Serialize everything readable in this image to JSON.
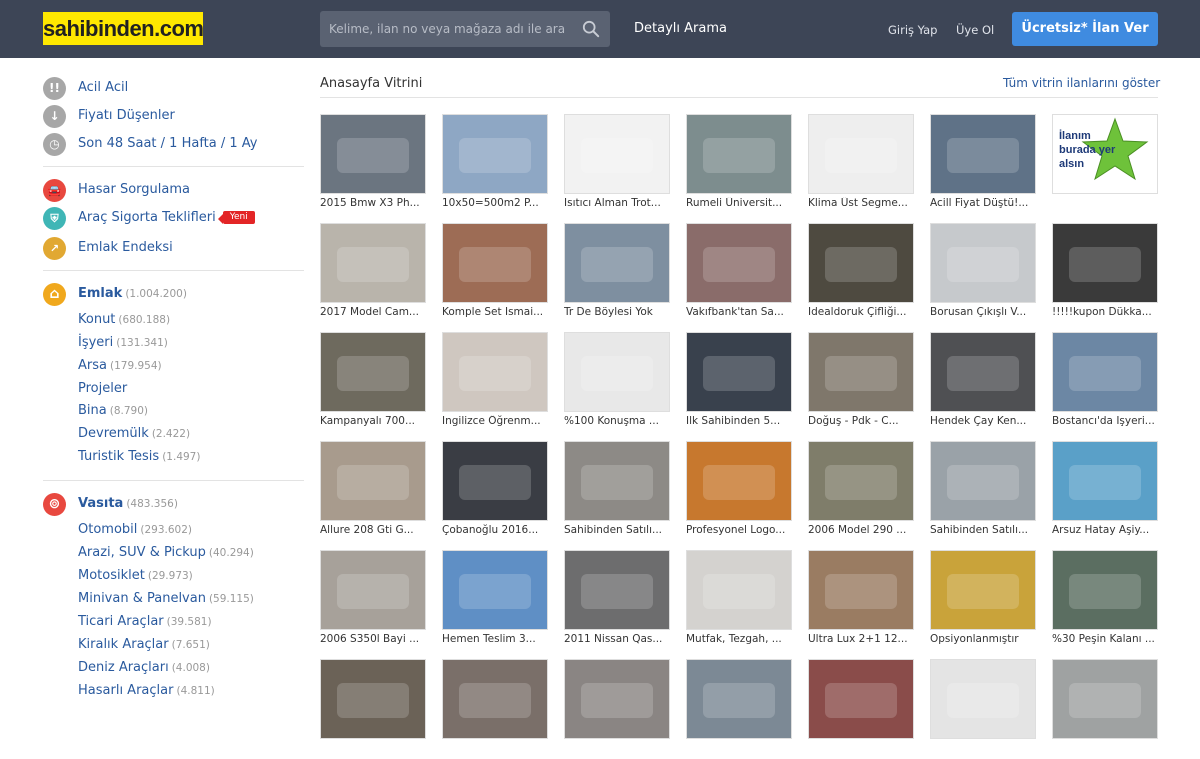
{
  "header": {
    "logo": "sahibinden.com",
    "search_placeholder": "Kelime, ilan no veya mağaza adı ile ara",
    "detailed_search": "Detaylı Arama",
    "login": "Giriş Yap",
    "register": "Üye Ol",
    "post_ad": "Ücretsiz* İlan Ver"
  },
  "sidebar": {
    "quick": [
      {
        "label": "Acil Acil",
        "icon": "exclamation-icon",
        "color": "#a7a7a7",
        "glyph": "!!"
      },
      {
        "label": "Fiyatı Düşenler",
        "icon": "arrow-down-icon",
        "color": "#a7a7a7",
        "glyph": "↓"
      },
      {
        "label": "Son 48 Saat / 1 Hafta / 1 Ay",
        "icon": "clock-icon",
        "color": "#a7a7a7",
        "glyph": "◷"
      }
    ],
    "tools": [
      {
        "label": "Hasar Sorgulama",
        "icon": "car-damage-icon",
        "color": "#e8483f",
        "glyph": "🚘"
      },
      {
        "label": "Araç Sigorta Teklifleri",
        "icon": "car-insurance-icon",
        "color": "#3fb6b6",
        "glyph": "⛨",
        "badge": "Yeni"
      },
      {
        "label": "Emlak Endeksi",
        "icon": "chart-icon",
        "color": "#e1a832",
        "glyph": "↗"
      }
    ],
    "emlak": {
      "title": "Emlak",
      "count": "(1.004.200)",
      "icon": "home-icon",
      "color": "#f0a81d",
      "items": [
        {
          "label": "Konut",
          "count": "(680.188)"
        },
        {
          "label": "İşyeri",
          "count": "(131.341)"
        },
        {
          "label": "Arsa",
          "count": "(179.954)"
        },
        {
          "label": "Projeler",
          "count": ""
        },
        {
          "label": "Bina",
          "count": "(8.790)"
        },
        {
          "label": "Devremülk",
          "count": "(2.422)"
        },
        {
          "label": "Turistik Tesis",
          "count": "(1.497)"
        }
      ]
    },
    "vasita": {
      "title": "Vasıta",
      "count": "(483.356)",
      "icon": "car-icon",
      "color": "#e8483f",
      "items": [
        {
          "label": "Otomobil",
          "count": "(293.602)"
        },
        {
          "label": "Arazi, SUV & Pickup",
          "count": "(40.294)"
        },
        {
          "label": "Motosiklet",
          "count": "(29.973)"
        },
        {
          "label": "Minivan & Panelvan",
          "count": "(59.115)"
        },
        {
          "label": "Ticari Araçlar",
          "count": "(39.581)"
        },
        {
          "label": "Kiralık Araçlar",
          "count": "(7.651)"
        },
        {
          "label": "Deniz Araçları",
          "count": "(4.008)"
        },
        {
          "label": "Hasarlı Araçlar",
          "count": "(4.811)"
        }
      ]
    }
  },
  "main": {
    "title": "Anasayfa Vitrini",
    "show_all": "Tüm vitrin ilanlarını göster",
    "listings": [
      {
        "caption": "2015 Bmw X3 Ph...",
        "bg": "#6b7580"
      },
      {
        "caption": "10x50=500m2 P...",
        "bg": "#8ea7c4"
      },
      {
        "caption": "Isıtıcı Alman Trot...",
        "bg": "#f2f2f2"
      },
      {
        "caption": "Rumeli Üniversit...",
        "bg": "#7d8d8e"
      },
      {
        "caption": "Klima Üst Segme...",
        "bg": "#eeeeee"
      },
      {
        "caption": "Acill Fiyat Düştü!...",
        "bg": "#5f7287"
      },
      {
        "caption": "",
        "bg": "#ffffff",
        "ad": "İlanım burada yer alsın"
      },
      {
        "caption": "2017 Model Cam...",
        "bg": "#b9b4ab"
      },
      {
        "caption": "Komple Set Ismai...",
        "bg": "#9d6c55"
      },
      {
        "caption": "Tr De Böylesi Yok",
        "bg": "#7e8fa0"
      },
      {
        "caption": "Vakıfbank'tan Sa...",
        "bg": "#8a6c6a"
      },
      {
        "caption": "Idealdoruk Çifliği...",
        "bg": "#4e4a40"
      },
      {
        "caption": "Borusan Çıkışlı V...",
        "bg": "#c6c9cc"
      },
      {
        "caption": "!!!!!kupon Dükka...",
        "bg": "#3a3a3a"
      },
      {
        "caption": "Kampanyalı 700...",
        "bg": "#6e6a5e"
      },
      {
        "caption": "Ingilizce Öğrenm...",
        "bg": "#cfc7c0"
      },
      {
        "caption": "%100 Konuşma ...",
        "bg": "#e8e8e8"
      },
      {
        "caption": "Ilk Sahibinden 5...",
        "bg": "#39414d"
      },
      {
        "caption": "Doğuş - Pdk - C...",
        "bg": "#7f776b"
      },
      {
        "caption": "Hendek Çay Ken...",
        "bg": "#4f5053"
      },
      {
        "caption": "Bostancı'da Işyeri...",
        "bg": "#6c87a4"
      },
      {
        "caption": "Allure 208 Gti G...",
        "bg": "#a89b8d"
      },
      {
        "caption": "Çobanoğlu 2016...",
        "bg": "#3a3d44"
      },
      {
        "caption": "Sahibinden Satılı...",
        "bg": "#8d8a86"
      },
      {
        "caption": "Profesyonel Logo...",
        "bg": "#c7782e"
      },
      {
        "caption": "2006 Model 290 ...",
        "bg": "#7f7d6a"
      },
      {
        "caption": "Sahibinden Satılı...",
        "bg": "#9aa2a8"
      },
      {
        "caption": "Arsuz Hatay Aşiy...",
        "bg": "#5aa0c8"
      },
      {
        "caption": "2006 S350l Bayi ...",
        "bg": "#a7a19a"
      },
      {
        "caption": "Hemen Teslim 3...",
        "bg": "#5f8fc5"
      },
      {
        "caption": "2011 Nissan Qas...",
        "bg": "#6d6d6e"
      },
      {
        "caption": "Mutfak, Tezgah, ...",
        "bg": "#d4d2cf"
      },
      {
        "caption": "Ultra Lux 2+1 12...",
        "bg": "#9a7c62"
      },
      {
        "caption": "Opsiyonlanmıştır",
        "bg": "#c9a33a"
      },
      {
        "caption": "%30 Peşin Kalanı ...",
        "bg": "#5b6e61"
      },
      {
        "caption": "",
        "bg": "#6b6257"
      },
      {
        "caption": "",
        "bg": "#7a6f69"
      },
      {
        "caption": "",
        "bg": "#8a8583"
      },
      {
        "caption": "",
        "bg": "#7c8995"
      },
      {
        "caption": "",
        "bg": "#8a4c4a"
      },
      {
        "caption": "",
        "bg": "#e4e4e4"
      },
      {
        "caption": "",
        "bg": "#9fa2a2"
      }
    ]
  }
}
